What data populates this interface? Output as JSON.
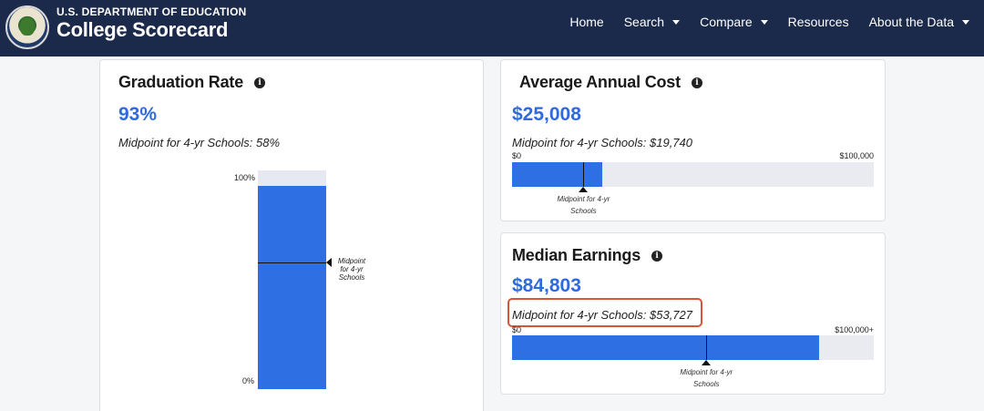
{
  "header": {
    "agency": "U.S. DEPARTMENT OF EDUCATION",
    "brand": "College Scorecard",
    "nav": [
      {
        "label": "Home",
        "dropdown": false
      },
      {
        "label": "Search",
        "dropdown": true
      },
      {
        "label": "Compare",
        "dropdown": true
      },
      {
        "label": "Resources",
        "dropdown": false
      },
      {
        "label": "About the Data",
        "dropdown": true
      }
    ]
  },
  "graduation": {
    "title": "Graduation Rate",
    "value": "93%",
    "midpoint_text": "Midpoint for 4-yr Schools: 58%",
    "tick_top": "100%",
    "tick_bottom": "0%",
    "midpoint_label": "Midpoint for 4-yr Schools",
    "value_fraction": 0.93,
    "midpoint_fraction": 0.58
  },
  "cost": {
    "title": "Average Annual Cost",
    "value": "$25,008",
    "midpoint_text": "Midpoint for 4-yr Schools: $19,740",
    "min_label": "$0",
    "max_label": "$100,000",
    "midpoint_label": "Midpoint for 4-yr Schools",
    "value_fraction": 0.25008,
    "midpoint_fraction": 0.1974
  },
  "earnings": {
    "title": "Median Earnings",
    "value": "$84,803",
    "midpoint_text": "Midpoint for 4-yr Schools: $53,727",
    "min_label": "$0",
    "max_label": "$100,000+",
    "midpoint_label": "Midpoint for 4-yr Schools",
    "value_fraction": 0.84803,
    "midpoint_fraction": 0.53727
  },
  "colors": {
    "header_bg": "#1b2a4a",
    "accent_blue": "#2f6fe4",
    "value_blue": "#2e6bde",
    "highlight": "#d9533b"
  }
}
